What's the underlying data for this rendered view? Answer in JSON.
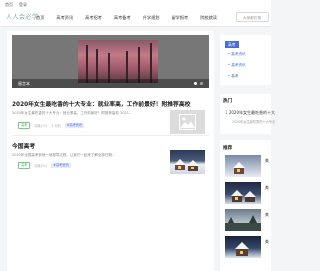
{
  "topbar": {
    "left_link": "首页",
    "right_link": "登录"
  },
  "header": {
    "logo": "人人会必学",
    "nav": [
      "首页",
      "高考资讯",
      "高考招考",
      "高考备考",
      "升学规划",
      "留学报考",
      "院校就读"
    ],
    "search_placeholder": "大家都在搜"
  },
  "slider": {
    "caption": "留言本"
  },
  "posts": [
    {
      "title": "2020年女生最吃香的十大专业：就业率高，工作前景好！附推荐高校",
      "excerpt": "2020年女生最吃香的十大专业：就业率高，工作前景好！附推荐高校 2021...",
      "tag": "高考",
      "views": "阅读(17)",
      "date": "7 天前",
      "category": "#高考资讯"
    },
    {
      "title": "今国高考",
      "excerpt": "2020年全国高考到地一地报导过程，让我们一起来了解全部日期...",
      "tag": "高考",
      "views": "阅读(51)",
      "date": "",
      "category": "#高考资讯"
    }
  ],
  "sidebar": {
    "tag": "高考",
    "links": [
      "高考资讯",
      "高考资讯",
      "高考"
    ],
    "hot_title": "热门",
    "hot_items": [
      {
        "rank": "1",
        "title": "2020年女生最吃香的十大",
        "sub": "2020年女生最吃香的十大专业"
      }
    ],
    "rec_title": "推荐",
    "rec_items": [
      "美",
      "美",
      "美",
      "美"
    ]
  },
  "colors": {
    "accent": "#4a6fd4",
    "tag_green": "#4aa55c"
  }
}
